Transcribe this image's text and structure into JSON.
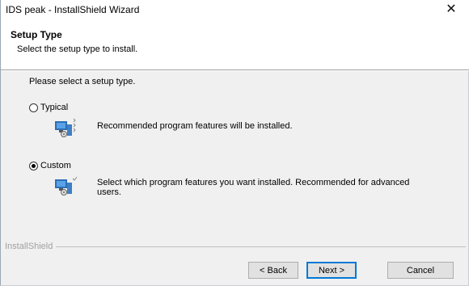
{
  "window": {
    "title": "IDS peak - InstallShield Wizard",
    "close_glyph": "✕"
  },
  "header": {
    "title": "Setup Type",
    "subtitle": "Select the setup type to install."
  },
  "main": {
    "prompt": "Please select a setup type.",
    "options": [
      {
        "label": "Typical",
        "selected": false,
        "icon": "typical-setup-icon",
        "description": "Recommended program features will be installed."
      },
      {
        "label": "Custom",
        "selected": true,
        "icon": "custom-setup-icon",
        "description": "Select which program features you want installed. Recommended for advanced users."
      }
    ]
  },
  "footer": {
    "brand": "InstallShield",
    "back_label": "< Back",
    "next_label": "Next >",
    "cancel_label": "Cancel"
  },
  "colors": {
    "default_button_border": "#0078d7",
    "header_bg": "#ffffff",
    "body_bg": "#f0f0f0"
  }
}
